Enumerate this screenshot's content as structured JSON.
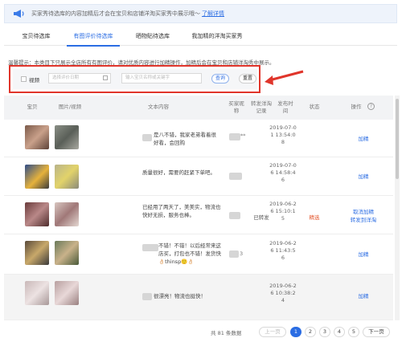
{
  "notice": {
    "text": "买家秀待选库的内容加精后才会在宝贝和店铺洋淘买家秀中展示哦～",
    "link": "了解详情"
  },
  "tabs": [
    {
      "label": "宝贝待选库"
    },
    {
      "label": "有图评价待选库"
    },
    {
      "label": "晒物贴待选库"
    },
    {
      "label": "我加精的洋淘买家秀"
    }
  ],
  "hint": "温馨提示：本类目下只展示全店所有有图评价，请对优质内容进行加精操作，加精后会在宝贝和店铺洋淘秀中展示。",
  "filter": {
    "checkbox_label": "视频",
    "date_placeholder": "选择评价日期",
    "keyword_placeholder": "输入宝贝名称或关键字",
    "search": "查询",
    "reset": "重置"
  },
  "table": {
    "headers": [
      "宝贝",
      "图片/视频",
      "文本内容",
      "买家昵称",
      "转发洋淘记录",
      "发布时间",
      "状态",
      "操作"
    ],
    "rows": [
      {
        "comment": "是八不错，我家老弟看着很好看，会回购",
        "nick": "**",
        "forward": "",
        "time": "2019-07-01 13:54:08",
        "status": "",
        "ops": [
          "加精"
        ]
      },
      {
        "comment": "质量很好，需要的赶紧下单吧。",
        "nick": "",
        "forward": "",
        "time": "2019-07-06 14:58:46",
        "status": "",
        "ops": [
          "加精"
        ]
      },
      {
        "comment": "已经用了两天了，美美实，物流也快好无损，服务也棒。",
        "nick": "",
        "forward": "已转发",
        "time": "2019-06-26 15:10:15",
        "status": "精选",
        "ops": [
          "取消加精",
          "转发到洋淘"
        ]
      },
      {
        "comment": "不错！不错！以后经常来这店买，打包也不错！发货快👌🏻thinsp🙂👌🏻",
        "nick": "3",
        "forward": "",
        "time": "2019-06-26 11:43:56",
        "status": "",
        "ops": [
          "加精"
        ]
      },
      {
        "comment": "很漂亮！物流也挺快！",
        "nick": "",
        "forward": "",
        "time": "2019-06-26 10:38:24",
        "status": "",
        "ops": [
          "加精"
        ]
      }
    ]
  },
  "pager": {
    "total": "共 81 条数据",
    "prev": "上一页",
    "pages": [
      "1",
      "2",
      "3",
      "4",
      "5"
    ],
    "next": "下一页"
  }
}
